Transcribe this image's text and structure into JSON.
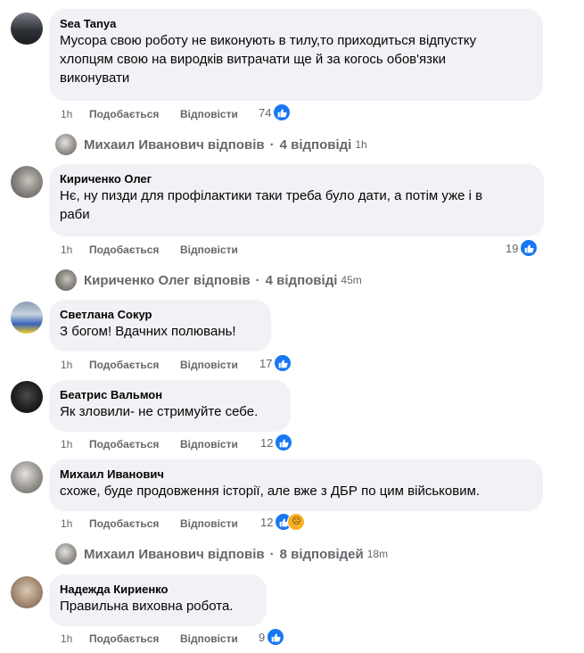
{
  "comments": [
    {
      "author": "Sea Tanya",
      "lines": [
        "Мусора свою роботу не виконують в тилу,то приходиться відпустку",
        "хлопцям свою на виродків витрачати ще й за когось обов'язки",
        "виконувати"
      ],
      "time": "1h",
      "like": "Подобається",
      "reply": "Відповісти",
      "reactions": "74",
      "reaction_icons": [
        "like-icon"
      ]
    },
    {
      "author": "Кириченко Олег",
      "lines": [
        "Нє, ну пизди для профілактики таки треба було дати, а потім уже і в",
        "раби"
      ],
      "time": "1h",
      "like": "Подобається",
      "reply": "Відповісти",
      "reactions": "19",
      "reaction_icons": [
        "like-icon"
      ]
    },
    {
      "author": "Светлана Сокур",
      "lines": [
        "З богом! Вдачних полювань!"
      ],
      "time": "1h",
      "like": "Подобається",
      "reply": "Відповісти",
      "reactions": "17",
      "reaction_icons": [
        "like-icon"
      ]
    },
    {
      "author": "Беатрис Вальмон",
      "lines": [
        "Як зловили- не стримуйте себе."
      ],
      "time": "1h",
      "like": "Подобається",
      "reply": "Відповісти",
      "reactions": "12",
      "reaction_icons": [
        "like-icon"
      ]
    },
    {
      "author": "Михаил Иванович",
      "lines": [
        "схоже, буде продовження історії, але вже з ДБР по цим військовим."
      ],
      "time": "1h",
      "like": "Подобається",
      "reply": "Відповісти",
      "reactions": "12",
      "reaction_icons": [
        "like-icon",
        "sad-icon"
      ]
    },
    {
      "author": "Надежда Кириенко",
      "lines": [
        "Правильна виховна робота."
      ],
      "time": "1h",
      "like": "Подобається",
      "reply": "Відповісти",
      "reactions": "9",
      "reaction_icons": [
        "like-icon"
      ]
    }
  ],
  "reply_threads": [
    {
      "name": "Михаил Иванович",
      "verb": "відповів",
      "count": "4 відповіді",
      "ago": "1h"
    },
    {
      "name": "Кириченко Олег",
      "verb": "відповів",
      "count": "4 відповіді",
      "ago": "45m"
    },
    {
      "name": "Михаил Иванович",
      "verb": "відповів",
      "count": "8 відповідей",
      "ago": "18m"
    }
  ],
  "sad_glyph": "☹",
  "colors": {
    "bubble_bg": "#f0f2f5",
    "meta_text": "#65676b",
    "like_blue": "#1877f2",
    "sad_yellow": "#f7b125"
  }
}
